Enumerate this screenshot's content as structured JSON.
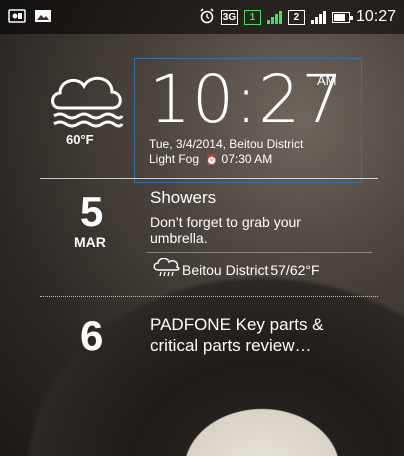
{
  "status_bar": {
    "time": "10:27",
    "network_label": "3G",
    "sim1": "1",
    "sim2": "2",
    "left_icons": [
      "usb-debug-icon",
      "image-icon"
    ],
    "right_icons": [
      "alarm-icon",
      "3g-icon",
      "sim1-icon",
      "signal-icon",
      "sim2-icon",
      "signal-icon",
      "battery-icon"
    ]
  },
  "weather": {
    "icon": "fog-cloud-icon",
    "temperature": "60°F"
  },
  "clock": {
    "time": "10:27",
    "ampm": "AM",
    "date_location": "Tue, 3/4/2014, Beitou District",
    "condition": "Light Fog",
    "alarm_icon": "⏰",
    "alarm_time": "07:30 AM"
  },
  "events": [
    {
      "day": "5",
      "month": "MAR",
      "title": "Showers",
      "description": "Don’t forget to grab your umbrella.",
      "forecast_icon": "rain-cloud-icon",
      "location": "Beitou District",
      "temps": "57/62°F"
    },
    {
      "day": "6",
      "title": "PADFONE Key parts & critical parts review…"
    }
  ],
  "colors": {
    "accent_border": "#3a6ea5",
    "status_green": "#4cd964"
  }
}
